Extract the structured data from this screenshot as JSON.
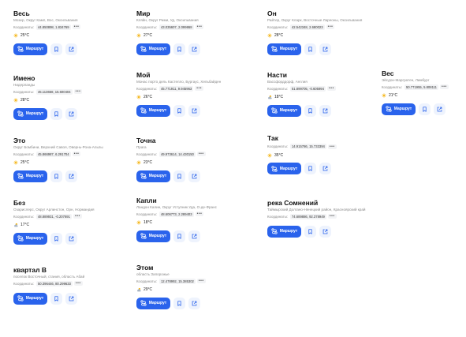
{
  "labels": {
    "coordinates": "Координаты:",
    "route": "Маршрут",
    "more": "•••"
  },
  "colors": {
    "accent": "#2a63ec",
    "icon_button_bg": "#eef3fd",
    "sun": "#f5b820",
    "cloud": "#a7b4c2"
  },
  "icons": {
    "route": "route-icon",
    "bookmark": "bookmark-icon",
    "share": "share-icon",
    "sun": "sun-icon",
    "cloud": "cloud-icon"
  },
  "places": [
    {
      "name": "Весь",
      "address": "Мозер, Округ Камп, Вос, Оксильвания",
      "coords": "44.850898, 1.834769",
      "weather_icon": "sun",
      "temp": "25°C"
    },
    {
      "name": "Мир",
      "address": "Кляйн, Округ Рими, Уд, Оксильвания",
      "coords": "43.035607, 2.099868",
      "weather_icon": "sun",
      "temp": "27°C"
    },
    {
      "name": "Он",
      "address": "Райтер, Округ Кларк, Восточные Лареоны, Оксильвания",
      "coords": "42.542348, 2.680023",
      "weather_icon": "sun",
      "temp": "28°C"
    },
    {
      "name": "Имено",
      "address": "Нидерланды",
      "coords": "45.113658, 15.600404",
      "weather_icon": "sun",
      "temp": "28°C"
    },
    {
      "name": "Мой",
      "address": "Монас порто дель Кастелло, Бургаус, Хельбайден",
      "coords": "45.771911, 9.945963",
      "weather_icon": "sun",
      "temp": "26°C"
    },
    {
      "name": "Насти",
      "address": "Вассфорддорф, Англия",
      "coords": "51.899705, -0.605994",
      "weather_icon": "cloud",
      "temp": "18°C"
    },
    {
      "name": "Вес",
      "address": "Эйсдон-Маргратен, Лимбург",
      "coords": "50.771955, 5.808111",
      "weather_icon": "sun",
      "temp": "21°C"
    },
    {
      "name": "Это",
      "address": "Округ Бомбини, Верхний Савоя, Овернь-Рона-Альпы",
      "coords": "45.866987, 6.291704",
      "weather_icon": "sun",
      "temp": "25°C"
    },
    {
      "name": "Точна",
      "address": "Прага",
      "coords": "49.973614, 14.430150",
      "weather_icon": "sun",
      "temp": "23°C"
    },
    {
      "name": "Так",
      "address": "",
      "coords": "14.915786, 15.733394",
      "weather_icon": "sun",
      "temp": "35°C"
    },
    {
      "name": "Без",
      "address": "Озарислерс, Округ Арлинстон, Орн, Нормандия",
      "coords": "48.889931, -0.207691",
      "weather_icon": "cloud",
      "temp": "17°C"
    },
    {
      "name": "Капли",
      "address": "Ландон Калин, Округ Уступник Уда, О-де-Франс",
      "coords": "48.606773, 2.289403",
      "weather_icon": "sun",
      "temp": "18°C"
    },
    {
      "name": "река Сомнений",
      "address": "Таймырский Долгано-Ненецкий район, Красноярский край",
      "coords": "74.689886, 92.378949",
      "weather_icon": "",
      "temp": ""
    },
    {
      "name": "квартал В",
      "address": "поселок Восточный, стания, область Абай",
      "coords": "50.396446, 80.299633",
      "weather_icon": "",
      "temp": ""
    },
    {
      "name": "Этом",
      "address": "область Запорожье",
      "coords": "12.478992, 15.385302",
      "weather_icon": "cloud",
      "temp": "29°C"
    }
  ]
}
